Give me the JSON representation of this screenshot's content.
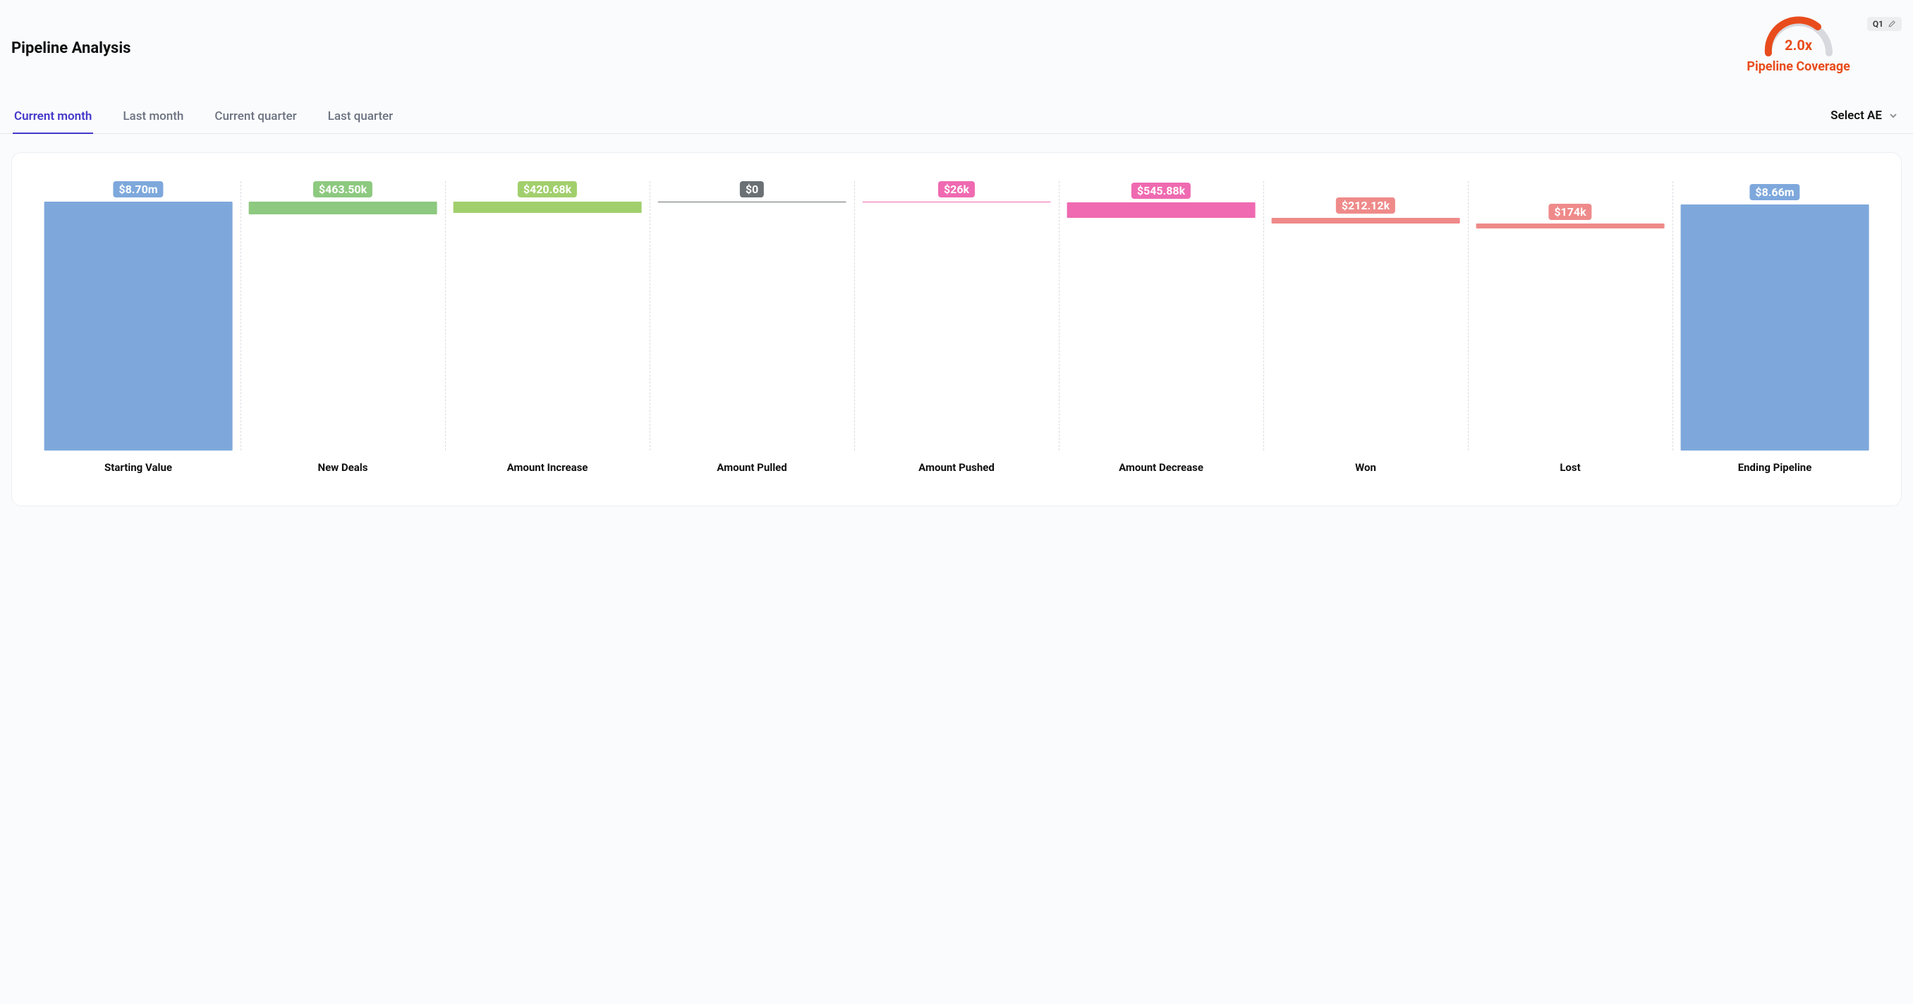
{
  "header": {
    "title": "Pipeline Analysis"
  },
  "coverage": {
    "value_label": "2.0x",
    "label": "Pipeline Coverage"
  },
  "quarter_badge": {
    "label": "Q1"
  },
  "tabs": {
    "items": [
      {
        "label": "Current month",
        "active": true
      },
      {
        "label": "Last month",
        "active": false
      },
      {
        "label": "Current quarter",
        "active": false
      },
      {
        "label": "Last quarter",
        "active": false
      }
    ]
  },
  "ae_selector": {
    "label": "Select AE"
  },
  "chart_data": {
    "type": "bar",
    "subtype": "waterfall",
    "title": "",
    "xlabel": "",
    "ylabel": "",
    "y_unit": "USD",
    "ylim_fraction": [
      0,
      1
    ],
    "categories": [
      "Starting Value",
      "New Deals",
      "Amount Increase",
      "Amount Pulled",
      "Amount Pushed",
      "Amount Decrease",
      "Won",
      "Lost",
      "Ending Pipeline"
    ],
    "value_labels": [
      "$8.70m",
      "$463.50k",
      "$420.68k",
      "$0",
      "$26k",
      "$545.88k",
      "$212.12k",
      "$174k",
      "$8.66m"
    ],
    "values_usd": [
      8700000,
      463500,
      420680,
      0,
      26000,
      545880,
      212120,
      174000,
      8660000
    ],
    "roles": [
      "total",
      "increase",
      "increase",
      "increase",
      "decrease",
      "decrease",
      "decrease",
      "decrease",
      "total"
    ],
    "colors": [
      "#7ea8dc",
      "#8dc97f",
      "#a2cf6d",
      "#6b7074",
      "#ef6ab1",
      "#ef6ab1",
      "#ef8a8a",
      "#ef8a8a",
      "#7ea8dc"
    ],
    "bar_geometry_fraction": [
      {
        "top": 0.075,
        "bottom": 1.0
      },
      {
        "top": 0.075,
        "bottom": 0.124
      },
      {
        "top": 0.075,
        "bottom": 0.119
      },
      {
        "top": 0.075,
        "bottom": 0.075
      },
      {
        "top": 0.075,
        "bottom": 0.079
      },
      {
        "top": 0.079,
        "bottom": 0.136
      },
      {
        "top": 0.136,
        "bottom": 0.158
      },
      {
        "top": 0.158,
        "bottom": 0.176
      },
      {
        "top": 0.086,
        "bottom": 1.0
      }
    ]
  }
}
